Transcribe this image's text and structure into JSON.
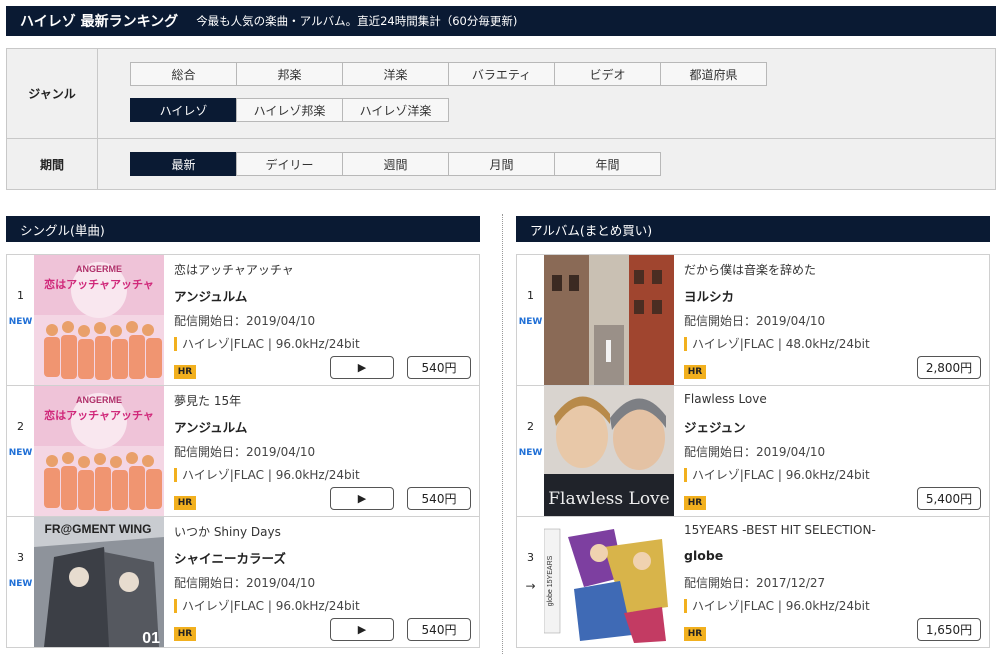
{
  "header": {
    "title": "ハイレゾ 最新ランキング",
    "subtitle": "今最も人気の楽曲・アルバム。直近24時間集計（60分毎更新)"
  },
  "filters": {
    "genre_label": "ジャンル",
    "genre_row1": [
      "総合",
      "邦楽",
      "洋楽",
      "バラエティ",
      "ビデオ",
      "都道府県"
    ],
    "genre_row2": [
      "ハイレゾ",
      "ハイレゾ邦楽",
      "ハイレゾ洋楽"
    ],
    "genre_active": "ハイレゾ",
    "period_label": "期間",
    "periods": [
      "最新",
      "デイリー",
      "週間",
      "月間",
      "年間"
    ],
    "period_active": "最新"
  },
  "singles": {
    "heading": "シングル(単曲)",
    "items": [
      {
        "rank": "1",
        "status": "NEW",
        "title": "恋はアッチャアッチャ",
        "artist": "アンジュルム",
        "date": "配信開始日：2019/04/10",
        "format": "ハイレゾ|FLAC | 96.0kHz/24bit",
        "badge": "HR",
        "play": "▶",
        "price": "540円",
        "art_text": "ANGERME",
        "art_sub": "恋はアッチャアッチャ"
      },
      {
        "rank": "2",
        "status": "NEW",
        "title": "夢見た 15年",
        "artist": "アンジュルム",
        "date": "配信開始日：2019/04/10",
        "format": "ハイレゾ|FLAC | 96.0kHz/24bit",
        "badge": "HR",
        "play": "▶",
        "price": "540円",
        "art_text": "ANGERME",
        "art_sub": "恋はアッチャアッチャ"
      },
      {
        "rank": "3",
        "status": "NEW",
        "title": "いつか Shiny Days",
        "artist": "シャイニーカラーズ",
        "date": "配信開始日：2019/04/10",
        "format": "ハイレゾ|FLAC | 96.0kHz/24bit",
        "badge": "HR",
        "play": "▶",
        "price": "540円",
        "art_text": "FR@GMENT WING",
        "art_sub": "01"
      }
    ]
  },
  "albums": {
    "heading": "アルバム(まとめ買い)",
    "items": [
      {
        "rank": "1",
        "status": "NEW",
        "title": "だから僕は音楽を辞めた",
        "artist": "ヨルシカ",
        "date": "配信開始日：2019/04/10",
        "format": "ハイレゾ|FLAC | 48.0kHz/24bit",
        "badge": "HR",
        "price": "2,800円"
      },
      {
        "rank": "2",
        "status": "NEW",
        "title": "Flawless Love",
        "artist": "ジェジュン",
        "date": "配信開始日：2019/04/10",
        "format": "ハイレゾ|FLAC | 96.0kHz/24bit",
        "badge": "HR",
        "price": "5,400円",
        "art_text": "Flawless Love"
      },
      {
        "rank": "3",
        "status": "→",
        "title": "15YEARS -BEST HIT SELECTION-",
        "artist": "globe",
        "date": "配信開始日：2017/12/27",
        "format": "ハイレゾ|FLAC | 96.0kHz/24bit",
        "badge": "HR",
        "price": "1,650円",
        "art_text": "globe 15YEARS"
      }
    ]
  },
  "colors": {
    "navy": "#0a1a33",
    "accent_yellow": "#f2b01e",
    "new_blue": "#1f6fd6"
  }
}
